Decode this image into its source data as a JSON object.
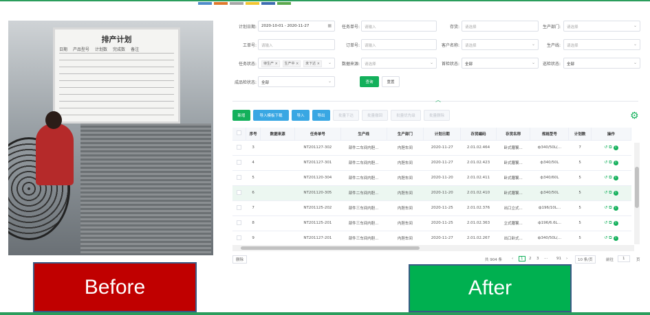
{
  "slides": {
    "before_label": "Before",
    "after_label": "After"
  },
  "photo": {
    "board_title": "排产计划",
    "board_headers": [
      "日期",
      "产品型号",
      "计划数",
      "完成数",
      "备注"
    ]
  },
  "form": {
    "plan_date_label": "计划日期:",
    "plan_date_value": "2020-10-01 - 2020-11-27",
    "task_no_label": "任务单号:",
    "task_no_ph": "请输入",
    "stock_label": "存货:",
    "stock_ph": "请选择",
    "dept_label": "生产部门:",
    "dept_ph": "请选择",
    "work_no_label": "工单号:",
    "work_no_ph": "请输入",
    "order_no_label": "订单号:",
    "order_no_ph": "请输入",
    "customer_label": "客户名称:",
    "customer_ph": "请选择",
    "line_label": "生产线:",
    "line_ph": "请选择",
    "task_status_label": "任务状态:",
    "task_status_tags": [
      "待生产",
      "生产中",
      "未下达"
    ],
    "data_source_label": "数据来源:",
    "data_source_ph": "请选择",
    "first_check_label": "首检状态:",
    "first_check_value": "全部",
    "patrol_label": "巡检状态:",
    "patrol_value": "全部",
    "finished_check_label": "成品检状态:",
    "finished_check_value": "全部",
    "query_btn": "查询",
    "reset_btn": "重置"
  },
  "toolbar": {
    "add": "新增",
    "import_tpl": "导入模板下载",
    "import": "导入",
    "export": "导出",
    "batch_issue": "批量下达",
    "batch_revoke": "批量撤回",
    "batch_priority": "批量优先级",
    "batch_delete": "批量删除"
  },
  "table": {
    "headers": [
      "序号",
      "数据来源",
      "任务单号",
      "生产线",
      "生产部门",
      "计划日期",
      "存货编码",
      "存货名称",
      "规格型号",
      "计划数",
      "操作"
    ],
    "rows": [
      [
        "3",
        "",
        "NT201127-302",
        "部件二车间内胆...",
        "内胆车间",
        "2020-11-27",
        "2.01.02.464",
        "卧式膳饕...",
        "ф340/50L(...",
        "7"
      ],
      [
        "4",
        "",
        "NT201127-301",
        "部件二车间内胆...",
        "内胆车间",
        "2020-11-27",
        "2.01.02.423",
        "卧式膳饕...",
        "ф340/50L",
        "5"
      ],
      [
        "5",
        "",
        "NT201120-304",
        "部件二车间内胆...",
        "内胆车间",
        "2020-11-20",
        "2.01.02.411",
        "卧式膳饕...",
        "ф340/60L",
        "5"
      ],
      [
        "6",
        "",
        "NT201120-305",
        "部件二车间内胆...",
        "内胆车间",
        "2020-11-20",
        "2.01.02.410",
        "卧式膳饕...",
        "ф340/50L",
        "5"
      ],
      [
        "7",
        "",
        "NT201125-202",
        "部件三车间内胆...",
        "内胆车间",
        "2020-11-25",
        "2.01.02.376",
        "出口立式...",
        "ф196/10L...",
        "5"
      ],
      [
        "8",
        "",
        "NT201125-201",
        "部件三车间内胆...",
        "内胆车间",
        "2020-11-25",
        "2.01.02.363",
        "立式膳饕...",
        "ф196/6.6L...",
        "5"
      ],
      [
        "9",
        "",
        "NT201127-201",
        "部件三车间内胆...",
        "内胆车间",
        "2020-11-27",
        "2.01.02.267",
        "出口卧式...",
        "ф340/50L(...",
        "5"
      ]
    ]
  },
  "pager": {
    "left_btn": "删除",
    "total": "共 904 条",
    "prev": "‹",
    "pages": [
      "1",
      "2",
      "3",
      "···",
      "91"
    ],
    "next": "›",
    "per_page": "10 条/页",
    "goto_label": "前往",
    "goto_value": "1",
    "page_suffix": "页"
  }
}
